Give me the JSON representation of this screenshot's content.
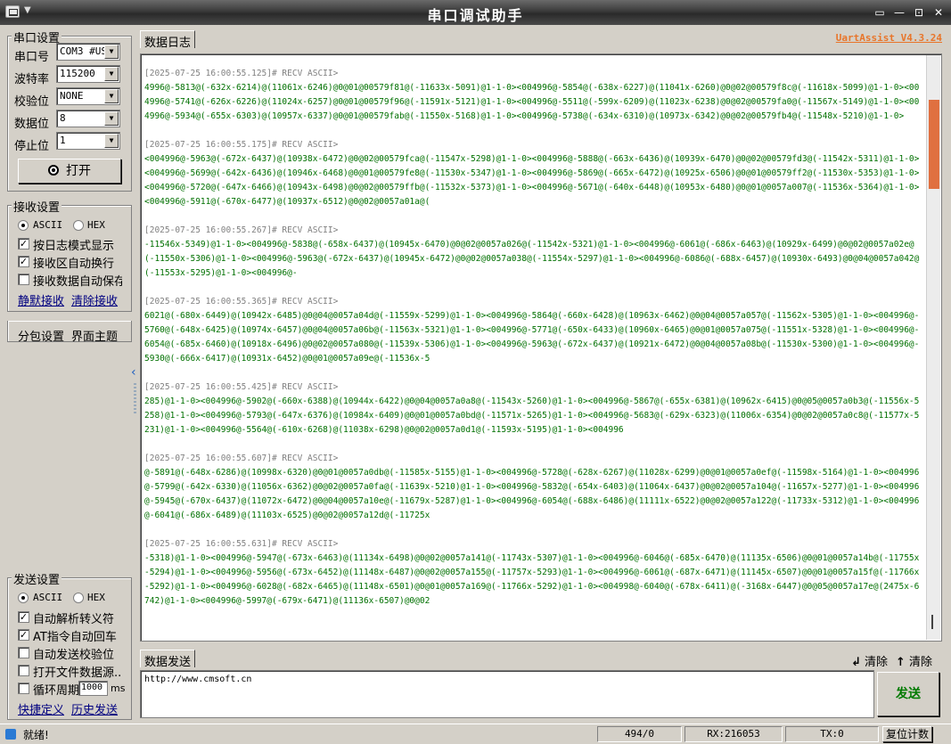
{
  "window": {
    "title": "串口调试助手",
    "menu_arrow": "▼",
    "min": "—",
    "max": "⊡",
    "close": "✕",
    "pin": "▭"
  },
  "serial": {
    "group_title": "串口设置",
    "port_label": "串口号",
    "port_value": "COM3 #USI",
    "baud_label": "波特率",
    "baud_value": "115200",
    "parity_label": "校验位",
    "parity_value": "NONE",
    "databits_label": "数据位",
    "databits_value": "8",
    "stopbits_label": "停止位",
    "stopbits_value": "1",
    "open_button": "打开"
  },
  "receive": {
    "group_title": "接收设置",
    "ascii": "ASCII",
    "hex": "HEX",
    "opt_log_mode": "按日志模式显示",
    "opt_wrap": "接收区自动换行",
    "opt_autosave": "接收数据自动保存...",
    "link_silent": "静默接收",
    "link_clear": "清除接收"
  },
  "tools": {
    "packet": "分包设置",
    "theme": "界面主题"
  },
  "send": {
    "group_title": "发送设置",
    "ascii": "ASCII",
    "hex": "HEX",
    "opt_escape": "自动解析转义符",
    "opt_at_crlf": "AT指令自动回车",
    "opt_checksum": "自动发送校验位",
    "opt_file": "打开文件数据源...",
    "opt_loop": "循环周期",
    "loop_ms": "1000",
    "loop_unit": "ms",
    "link_shortcut": "快捷定义",
    "link_history": "历史发送"
  },
  "log": {
    "tab": "数据日志",
    "version": "UartAssist V4.3.24",
    "entries": [
      {
        "ts": "[2025-07-25 16:00:55.125]# RECV ASCII>",
        "data": "4996@-5813@(-632x-6214)@(11061x-6246)@0@01@00579f81@(-11633x-5091)@1-1-0><004996@-5854@(-638x-6227)@(11041x-6260)@0@02@00579f8c@(-11618x-5099)@1-1-0><004996@-5741@(-626x-6226)@(11024x-6257)@0@01@00579f96@(-11591x-5121)@1-1-0><004996@-5511@(-599x-6209)@(11023x-6238)@0@02@00579fa0@(-11567x-5149)@1-1-0><004996@-5934@(-655x-6303)@(10957x-6337)@0@01@00579fab@(-11550x-5168)@1-1-0><004996@-5738@(-634x-6310)@(10973x-6342)@0@02@00579fb4@(-11548x-5210)@1-1-0>"
      },
      {
        "ts": "[2025-07-25 16:00:55.175]# RECV ASCII>",
        "data": "<004996@-5963@(-672x-6437)@(10938x-6472)@0@02@00579fca@(-11547x-5298)@1-1-0><004996@-5888@(-663x-6436)@(10939x-6470)@0@02@00579fd3@(-11542x-5311)@1-1-0><004996@-5699@(-642x-6436)@(10946x-6468)@0@01@00579fe8@(-11530x-5347)@1-1-0><004996@-5869@(-665x-6472)@(10925x-6506)@0@01@00579ff2@(-11530x-5353)@1-1-0><004996@-5720@(-647x-6466)@(10943x-6498)@0@02@00579ffb@(-11532x-5373)@1-1-0><004996@-5671@(-640x-6448)@(10953x-6480)@0@01@0057a007@(-11536x-5364)@1-1-0><004996@-5911@(-670x-6477)@(10937x-6512)@0@02@0057a01a@("
      },
      {
        "ts": "[2025-07-25 16:00:55.267]# RECV ASCII>",
        "data": "-11546x-5349)@1-1-0><004996@-5838@(-658x-6437)@(10945x-6470)@0@02@0057a026@(-11542x-5321)@1-1-0><004996@-6061@(-686x-6463)@(10929x-6499)@0@02@0057a02e@(-11550x-5306)@1-1-0><004996@-5963@(-672x-6437)@(10945x-6472)@0@02@0057a038@(-11554x-5297)@1-1-0><004996@-6086@(-688x-6457)@(10930x-6493)@0@04@0057a042@(-11553x-5295)@1-1-0><004996@-"
      },
      {
        "ts": "[2025-07-25 16:00:55.365]# RECV ASCII>",
        "data": "6021@(-680x-6449)@(10942x-6485)@0@04@0057a04d@(-11559x-5299)@1-1-0><004996@-5864@(-660x-6428)@(10963x-6462)@0@04@0057a057@(-11562x-5305)@1-1-0><004996@-5760@(-648x-6425)@(10974x-6457)@0@04@0057a06b@(-11563x-5321)@1-1-0><004996@-5771@(-650x-6433)@(10960x-6465)@0@01@0057a075@(-11551x-5328)@1-1-0><004996@-6054@(-685x-6460)@(10918x-6496)@0@02@0057a080@(-11539x-5306)@1-1-0><004996@-5963@(-672x-6437)@(10921x-6472)@0@04@0057a08b@(-11530x-5300)@1-1-0><004996@-5930@(-666x-6417)@(10931x-6452)@0@01@0057a09e@(-11536x-5"
      },
      {
        "ts": "[2025-07-25 16:00:55.425]# RECV ASCII>",
        "data": "285)@1-1-0><004996@-5902@(-660x-6388)@(10944x-6422)@0@04@0057a0a8@(-11543x-5260)@1-1-0><004996@-5867@(-655x-6381)@(10962x-6415)@0@05@0057a0b3@(-11556x-5258)@1-1-0><004996@-5793@(-647x-6376)@(10984x-6409)@0@01@0057a0bd@(-11571x-5265)@1-1-0><004996@-5683@(-629x-6323)@(11006x-6354)@0@02@0057a0c8@(-11577x-5231)@1-1-0><004996@-5564@(-610x-6268)@(11038x-6298)@0@02@0057a0d1@(-11593x-5195)@1-1-0><004996"
      },
      {
        "ts": "[2025-07-25 16:00:55.607]# RECV ASCII>",
        "data": "@-5891@(-648x-6286)@(10998x-6320)@0@01@0057a0db@(-11585x-5155)@1-1-0><004996@-5728@(-628x-6267)@(11028x-6299)@0@01@0057a0ef@(-11598x-5164)@1-1-0><004996@-5799@(-642x-6330)@(11056x-6362)@0@02@0057a0fa@(-11639x-5210)@1-1-0><004996@-5832@(-654x-6403)@(11064x-6437)@0@02@0057a104@(-11657x-5277)@1-1-0><004996@-5945@(-670x-6437)@(11072x-6472)@0@04@0057a10e@(-11679x-5287)@1-1-0><004996@-6054@(-688x-6486)@(11111x-6522)@0@02@0057a122@(-11733x-5312)@1-1-0><004996@-6041@(-686x-6489)@(11103x-6525)@0@02@0057a12d@(-11725x"
      },
      {
        "ts": "[2025-07-25 16:00:55.631]# RECV ASCII>",
        "data": "-5318)@1-1-0><004996@-5947@(-673x-6463)@(11134x-6498)@0@02@0057a141@(-11743x-5307)@1-1-0><004996@-6046@(-685x-6470)@(11135x-6506)@0@01@0057a14b@(-11755x-5294)@1-1-0><004996@-5956@(-673x-6452)@(11148x-6487)@0@02@0057a155@(-11757x-5293)@1-1-0><004996@-6061@(-687x-6471)@(11145x-6507)@0@01@0057a15f@(-11766x-5292)@1-1-0><004996@-6028@(-682x-6465)@(11148x-6501)@0@01@0057a169@(-11766x-5292)@1-1-0><004998@-6040@(-678x-6411)@(-3168x-6447)@0@05@0057a17e@(2475x-6742)@1-1-0><004996@-5997@(-679x-6471)@(11136x-6507)@0@02"
      }
    ]
  },
  "send_area": {
    "tab": "数据发送",
    "clear1": "清除",
    "clear2": "清除",
    "input_value": "http://www.cmsoft.cn",
    "send_button": "发送"
  },
  "status": {
    "ready": "就绪!",
    "count": "494/0",
    "rx": "RX:216053",
    "tx": "TX:0",
    "reset": "复位计数"
  }
}
